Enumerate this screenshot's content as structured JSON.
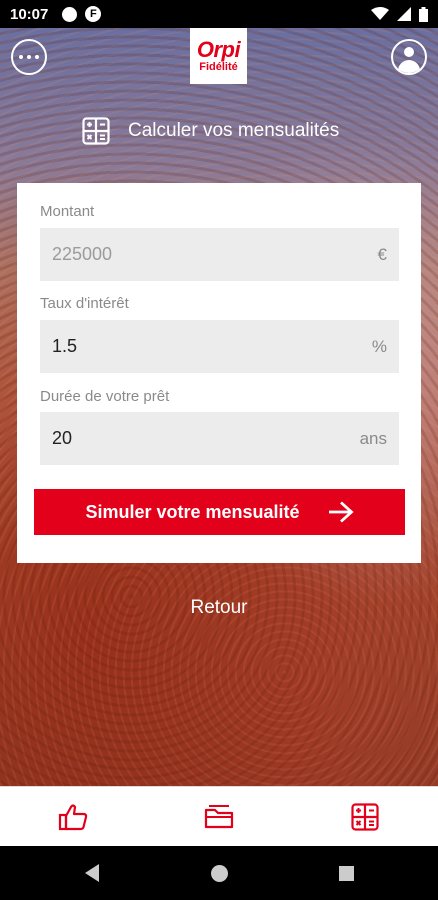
{
  "status_bar": {
    "time": "10:07",
    "f_badge": "F"
  },
  "logo": {
    "brand": "Orpi",
    "sub": "Fidélité"
  },
  "header": {
    "title": "Calculer vos mensualités"
  },
  "form": {
    "amount": {
      "label": "Montant",
      "value": "225000",
      "unit": "€"
    },
    "rate": {
      "label": "Taux d'intérêt",
      "value": "1.5",
      "unit": "%"
    },
    "duration": {
      "label": "Durée de votre prêt",
      "value": "20",
      "unit": "ans"
    },
    "submit_label": "Simuler votre mensualité"
  },
  "back_label": "Retour",
  "colors": {
    "accent": "#e3001b",
    "field_bg": "#ececec"
  },
  "icons": {
    "menu": "more-horizontal-icon",
    "profile": "user-icon",
    "calculator": "calculator-icon",
    "arrow": "arrow-right-icon",
    "nav_like": "thumbs-up-icon",
    "nav_folder": "folder-icon",
    "nav_calc": "calculator-icon"
  }
}
